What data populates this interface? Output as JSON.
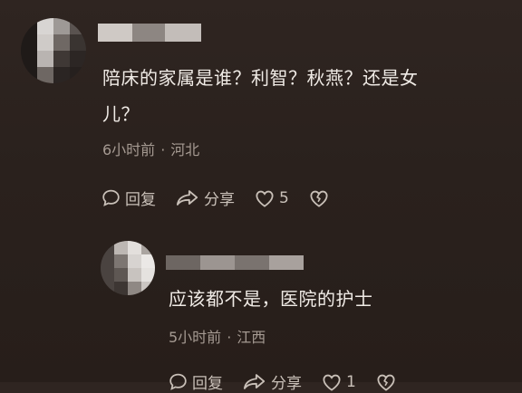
{
  "comment1": {
    "text_line1": "陪床的家属是谁？利智？秋燕？还是女",
    "text_line2": "儿？",
    "time": "6小时前",
    "location": "河北",
    "actions": {
      "reply": "回复",
      "share": "分享",
      "like_count": "5"
    }
  },
  "comment2": {
    "text": "应该都不是，医院的护士",
    "time": "5小时前",
    "location": "江西",
    "actions": {
      "reply": "回复",
      "share": "分享",
      "like_count": "1"
    }
  },
  "separator": "·"
}
